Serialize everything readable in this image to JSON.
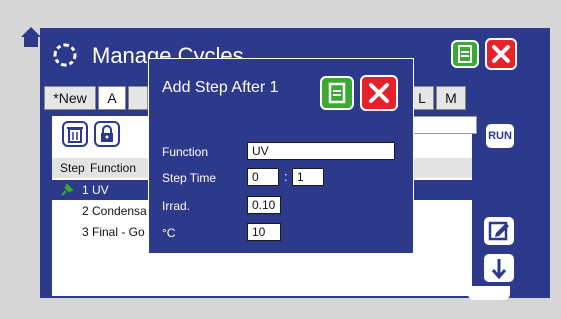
{
  "window": {
    "title": "Manage Cycles"
  },
  "tabs": [
    {
      "label": "*New"
    },
    {
      "label": "A"
    },
    {
      "label": "L"
    },
    {
      "label": "M"
    }
  ],
  "list": {
    "headers": {
      "step": "Step",
      "function": "Function"
    },
    "rows": [
      {
        "num": "1",
        "name": "UV",
        "selected": true
      },
      {
        "num": "2",
        "name": "Condensa"
      },
      {
        "num": "3",
        "name": "Final - Go"
      }
    ]
  },
  "side": {
    "run_label": "RUN"
  },
  "dialog": {
    "title": "Add Step After 1",
    "fields": {
      "function_label": "Function",
      "function_value": "UV",
      "step_time_label": "Step Time",
      "step_time_hours": "0",
      "step_time_sep": ":",
      "step_time_minutes": "1",
      "irrad_label": "Irrad.",
      "irrad_value": "0.10",
      "temp_label": "°C",
      "temp_value": "10"
    }
  },
  "icons": [
    "home-icon",
    "cycle-icon",
    "save-icon",
    "close-icon",
    "trash-icon",
    "lock-icon",
    "pin-icon",
    "edit-icon",
    "arrow-down-icon"
  ],
  "colors": {
    "panel": "#2d3a8c",
    "save": "#3aaa35",
    "close": "#e8202a",
    "background": "#d6d6d6"
  }
}
